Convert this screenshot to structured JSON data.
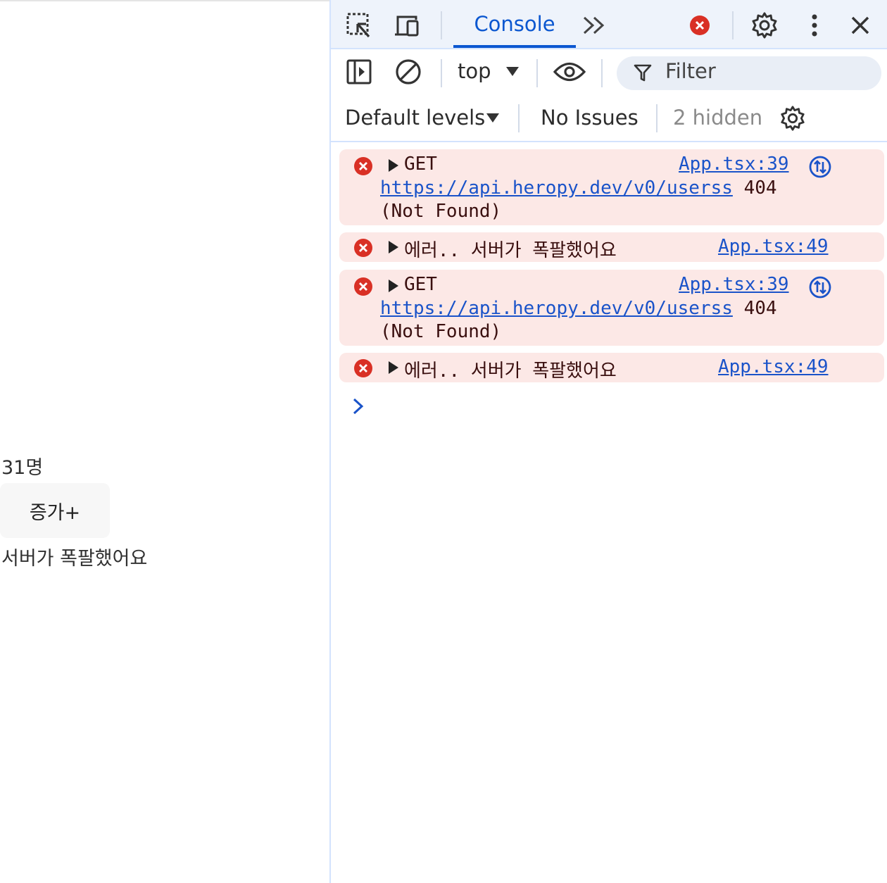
{
  "page": {
    "count_text": "31명",
    "increase_button": "증가+",
    "error_text": "서버가 폭팔했어요"
  },
  "devtools": {
    "tabs": {
      "console": "Console",
      "more_icon": "chevrons-right-icon"
    },
    "toolbar": {
      "context": "top",
      "filter_placeholder": "Filter",
      "levels": "Default levels",
      "issues": "No Issues",
      "hidden": "2 hidden"
    },
    "messages": [
      {
        "type": "error",
        "text": "GET",
        "url": "https://api.heropy.dev/v0/userss",
        "status": "404",
        "status_text": "(Not Found)",
        "source": "App.tsx:39"
      },
      {
        "type": "error",
        "text": "에러.. 서버가 폭팔했어요",
        "source": "App.tsx:49"
      },
      {
        "type": "error",
        "text": "GET",
        "url": "https://api.heropy.dev/v0/userss",
        "status": "404",
        "status_text": "(Not Found)",
        "source": "App.tsx:39"
      },
      {
        "type": "error",
        "text": "에러.. 서버가 폭팔했어요",
        "source": "App.tsx:49"
      }
    ],
    "colors": {
      "accent": "#0b57d0",
      "error_bg": "#fce8e6",
      "error_icon": "#d93025",
      "toolbar_bg": "#eef3fb"
    }
  }
}
